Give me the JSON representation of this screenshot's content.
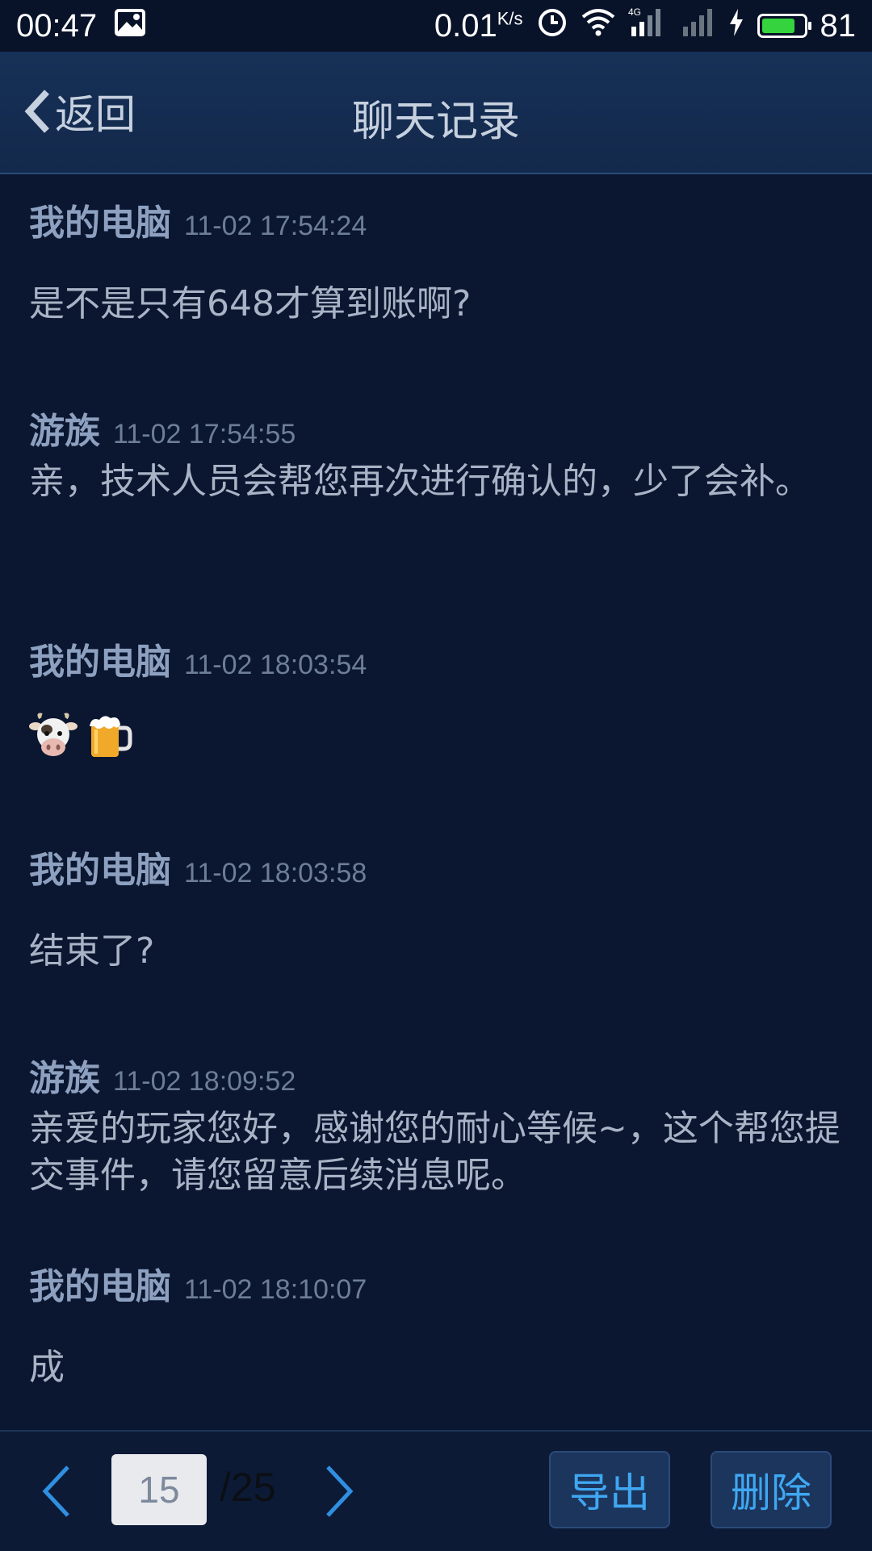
{
  "status_bar": {
    "time": "00:47",
    "speed_value": "0.01",
    "speed_unit": "K/s",
    "network_label": "4G",
    "battery_level": "81"
  },
  "header": {
    "back_label": "返回",
    "title": "聊天记录"
  },
  "messages": [
    {
      "sender": "我的电脑",
      "time": "11-02 17:54:24",
      "text": "是不是只有648才算到账啊?"
    },
    {
      "sender": "游族",
      "time": "11-02 17:54:55",
      "text": "亲，技术人员会帮您再次进行确认的，少了会补。"
    },
    {
      "sender": "我的电脑",
      "time": "11-02 18:03:54",
      "emojis": [
        "cow-face-emoji",
        "beer-mug-emoji"
      ]
    },
    {
      "sender": "我的电脑",
      "time": "11-02 18:03:58",
      "text": "结束了?"
    },
    {
      "sender": "游族",
      "time": "11-02 18:09:52",
      "text": "亲爱的玩家您好，感谢您的耐心等候~，这个帮您提交事件，请您留意后续消息呢。"
    },
    {
      "sender": "我的电脑",
      "time": "11-02 18:10:07",
      "text": "成"
    }
  ],
  "pagination": {
    "current_page": "15",
    "total_pages": "/25"
  },
  "actions": {
    "export_label": "导出",
    "delete_label": "删除"
  },
  "colors": {
    "background": "#0b1630",
    "header": "#163057",
    "accent": "#3fa7f2",
    "sender": "#8da0bf"
  }
}
